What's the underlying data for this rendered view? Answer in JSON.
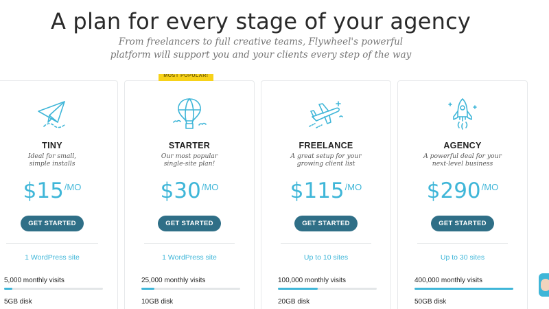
{
  "header": {
    "title": "A plan for every stage of your agency",
    "subtitle_line1": "From freelancers to full creative teams, Flywheel's powerful",
    "subtitle_line2": "platform will support you and your clients every step of the way"
  },
  "ribbon": {
    "label": "MOST POPULAR!"
  },
  "colors": {
    "accent": "#3fb6d8",
    "button": "#2f6f87",
    "ribbon": "#f7d21a"
  },
  "plans": [
    {
      "icon": "paper-plane-icon",
      "name": "TINY",
      "desc_line1": "Ideal for small,",
      "desc_line2": "simple installs",
      "price": "$15",
      "unit": "/MO",
      "cta": "GET STARTED",
      "sites": "1 WordPress site",
      "visits": "5,000 monthly visits",
      "visits_fraction": 0.08,
      "disk": "5GB disk"
    },
    {
      "icon": "hot-air-balloon-icon",
      "name": "STARTER",
      "desc_line1": "Our most popular",
      "desc_line2": "single-site plan!",
      "price": "$30",
      "unit": "/MO",
      "cta": "GET STARTED",
      "sites": "1 WordPress site",
      "visits": "25,000 monthly visits",
      "visits_fraction": 0.13,
      "disk": "10GB disk"
    },
    {
      "icon": "airplane-icon",
      "name": "FREELANCE",
      "desc_line1": "A great setup for your",
      "desc_line2": "growing client list",
      "price": "$115",
      "unit": "/MO",
      "cta": "GET STARTED",
      "sites": "Up to 10 sites",
      "visits": "100,000 monthly visits",
      "visits_fraction": 0.4,
      "disk": "20GB disk"
    },
    {
      "icon": "rocket-icon",
      "name": "AGENCY",
      "desc_line1": "A powerful deal for your",
      "desc_line2": "next-level business",
      "price": "$290",
      "unit": "/MO",
      "cta": "GET STARTED",
      "sites": "Up to 30 sites",
      "visits": "400,000 monthly visits",
      "visits_fraction": 1.0,
      "disk": "50GB disk"
    }
  ],
  "chat": {
    "icon": "chat-avatar-icon"
  }
}
